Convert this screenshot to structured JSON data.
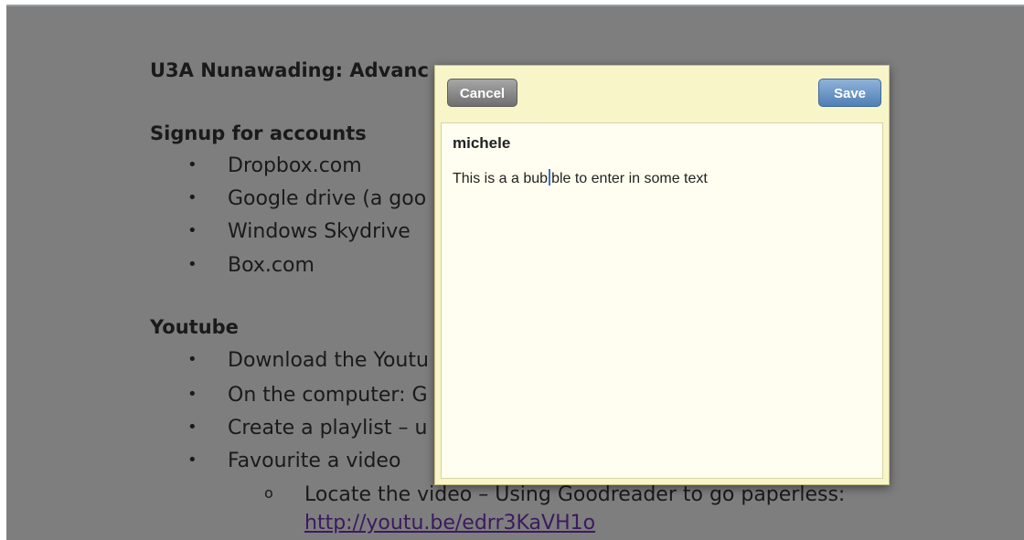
{
  "document": {
    "title": "U3A Nunawading:  Advanc",
    "signup_heading": "Signup for accounts",
    "signup_items": [
      "Dropbox.com",
      "Google drive  (a goo",
      "Windows Skydrive",
      "Box.com"
    ],
    "youtube_heading": "Youtube",
    "youtube_items": [
      "Download the Youtu",
      "On the computer: G",
      "Create a playlist – u",
      "Favourite a video"
    ],
    "sub_item": "Locate the video – Using Goodreader to go paperless:",
    "link": "http://youtu.be/edrr3KaVH1o",
    "bullet_glyph": "•",
    "sub_glyph": "o"
  },
  "note_popup": {
    "cancel_label": "Cancel",
    "save_label": "Save",
    "author": "michele",
    "text_before_caret": "This is a a bub",
    "text_after_caret": "ble to enter in some text",
    "colors": {
      "popup_background": "#f8f5c8",
      "save_button": "#4f7fb5",
      "cancel_button": "#7a7a7a",
      "caret": "#3a6fd8"
    }
  }
}
